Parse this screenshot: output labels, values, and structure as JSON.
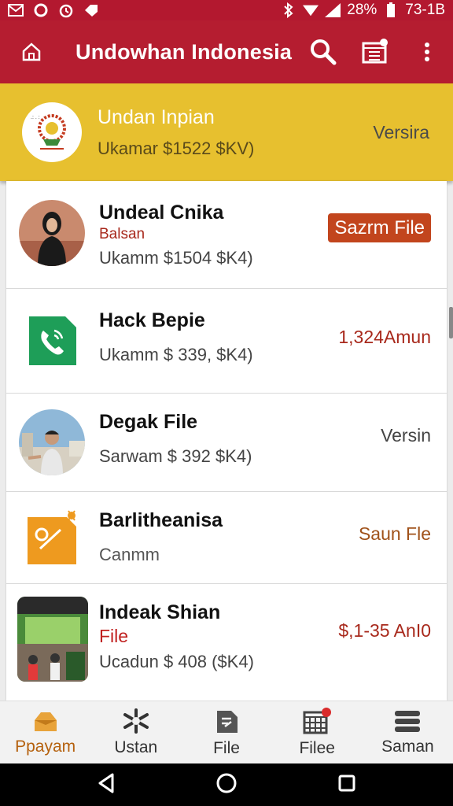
{
  "status_bar": {
    "battery": "28%",
    "time": "73-1B"
  },
  "app_bar": {
    "title": "Undowhan Indonesia"
  },
  "featured": {
    "name": "Undan Inpian",
    "subtitle": "Ukamar $1522 $KV)",
    "right_label": "Versira"
  },
  "items": [
    {
      "title": "Undeal Cnika",
      "tag": "Balsan",
      "meta": "Ukamm $1504 $K4)",
      "right": "Sazrm File",
      "right_style": "pill"
    },
    {
      "title": "Hack Bepie",
      "tag": "",
      "meta": "Ukamm $  339, $K4)",
      "right": "1,324Amun",
      "right_style": "red"
    },
    {
      "title": "Degak File",
      "tag": "",
      "meta": "Sarwam $  392 $K4)",
      "right": "Versin",
      "right_style": "gray"
    },
    {
      "title": "Barlitheanisa",
      "tag": "",
      "meta": "Canmm",
      "right": "Saun Fle",
      "right_style": "brown"
    },
    {
      "title": "Indeak Shian",
      "tag": "File",
      "meta": "Ucadun $  408 ($K4)",
      "right": "$,1-35 AnI0",
      "right_style": "red"
    }
  ],
  "bottom_nav": [
    {
      "label": "Ppayam",
      "icon": "home-fold-icon",
      "active": true
    },
    {
      "label": "Ustan",
      "icon": "sparkle-icon",
      "active": false
    },
    {
      "label": "File",
      "icon": "file-icon",
      "active": false
    },
    {
      "label": "Filee",
      "icon": "calendar-icon",
      "active": false
    },
    {
      "label": "Saman",
      "icon": "stack-icon",
      "active": false
    }
  ],
  "colors": {
    "primary": "#b51d30",
    "featured_bg": "#e7c02f",
    "accent_red": "#a8291c",
    "pill": "#c2451d"
  }
}
